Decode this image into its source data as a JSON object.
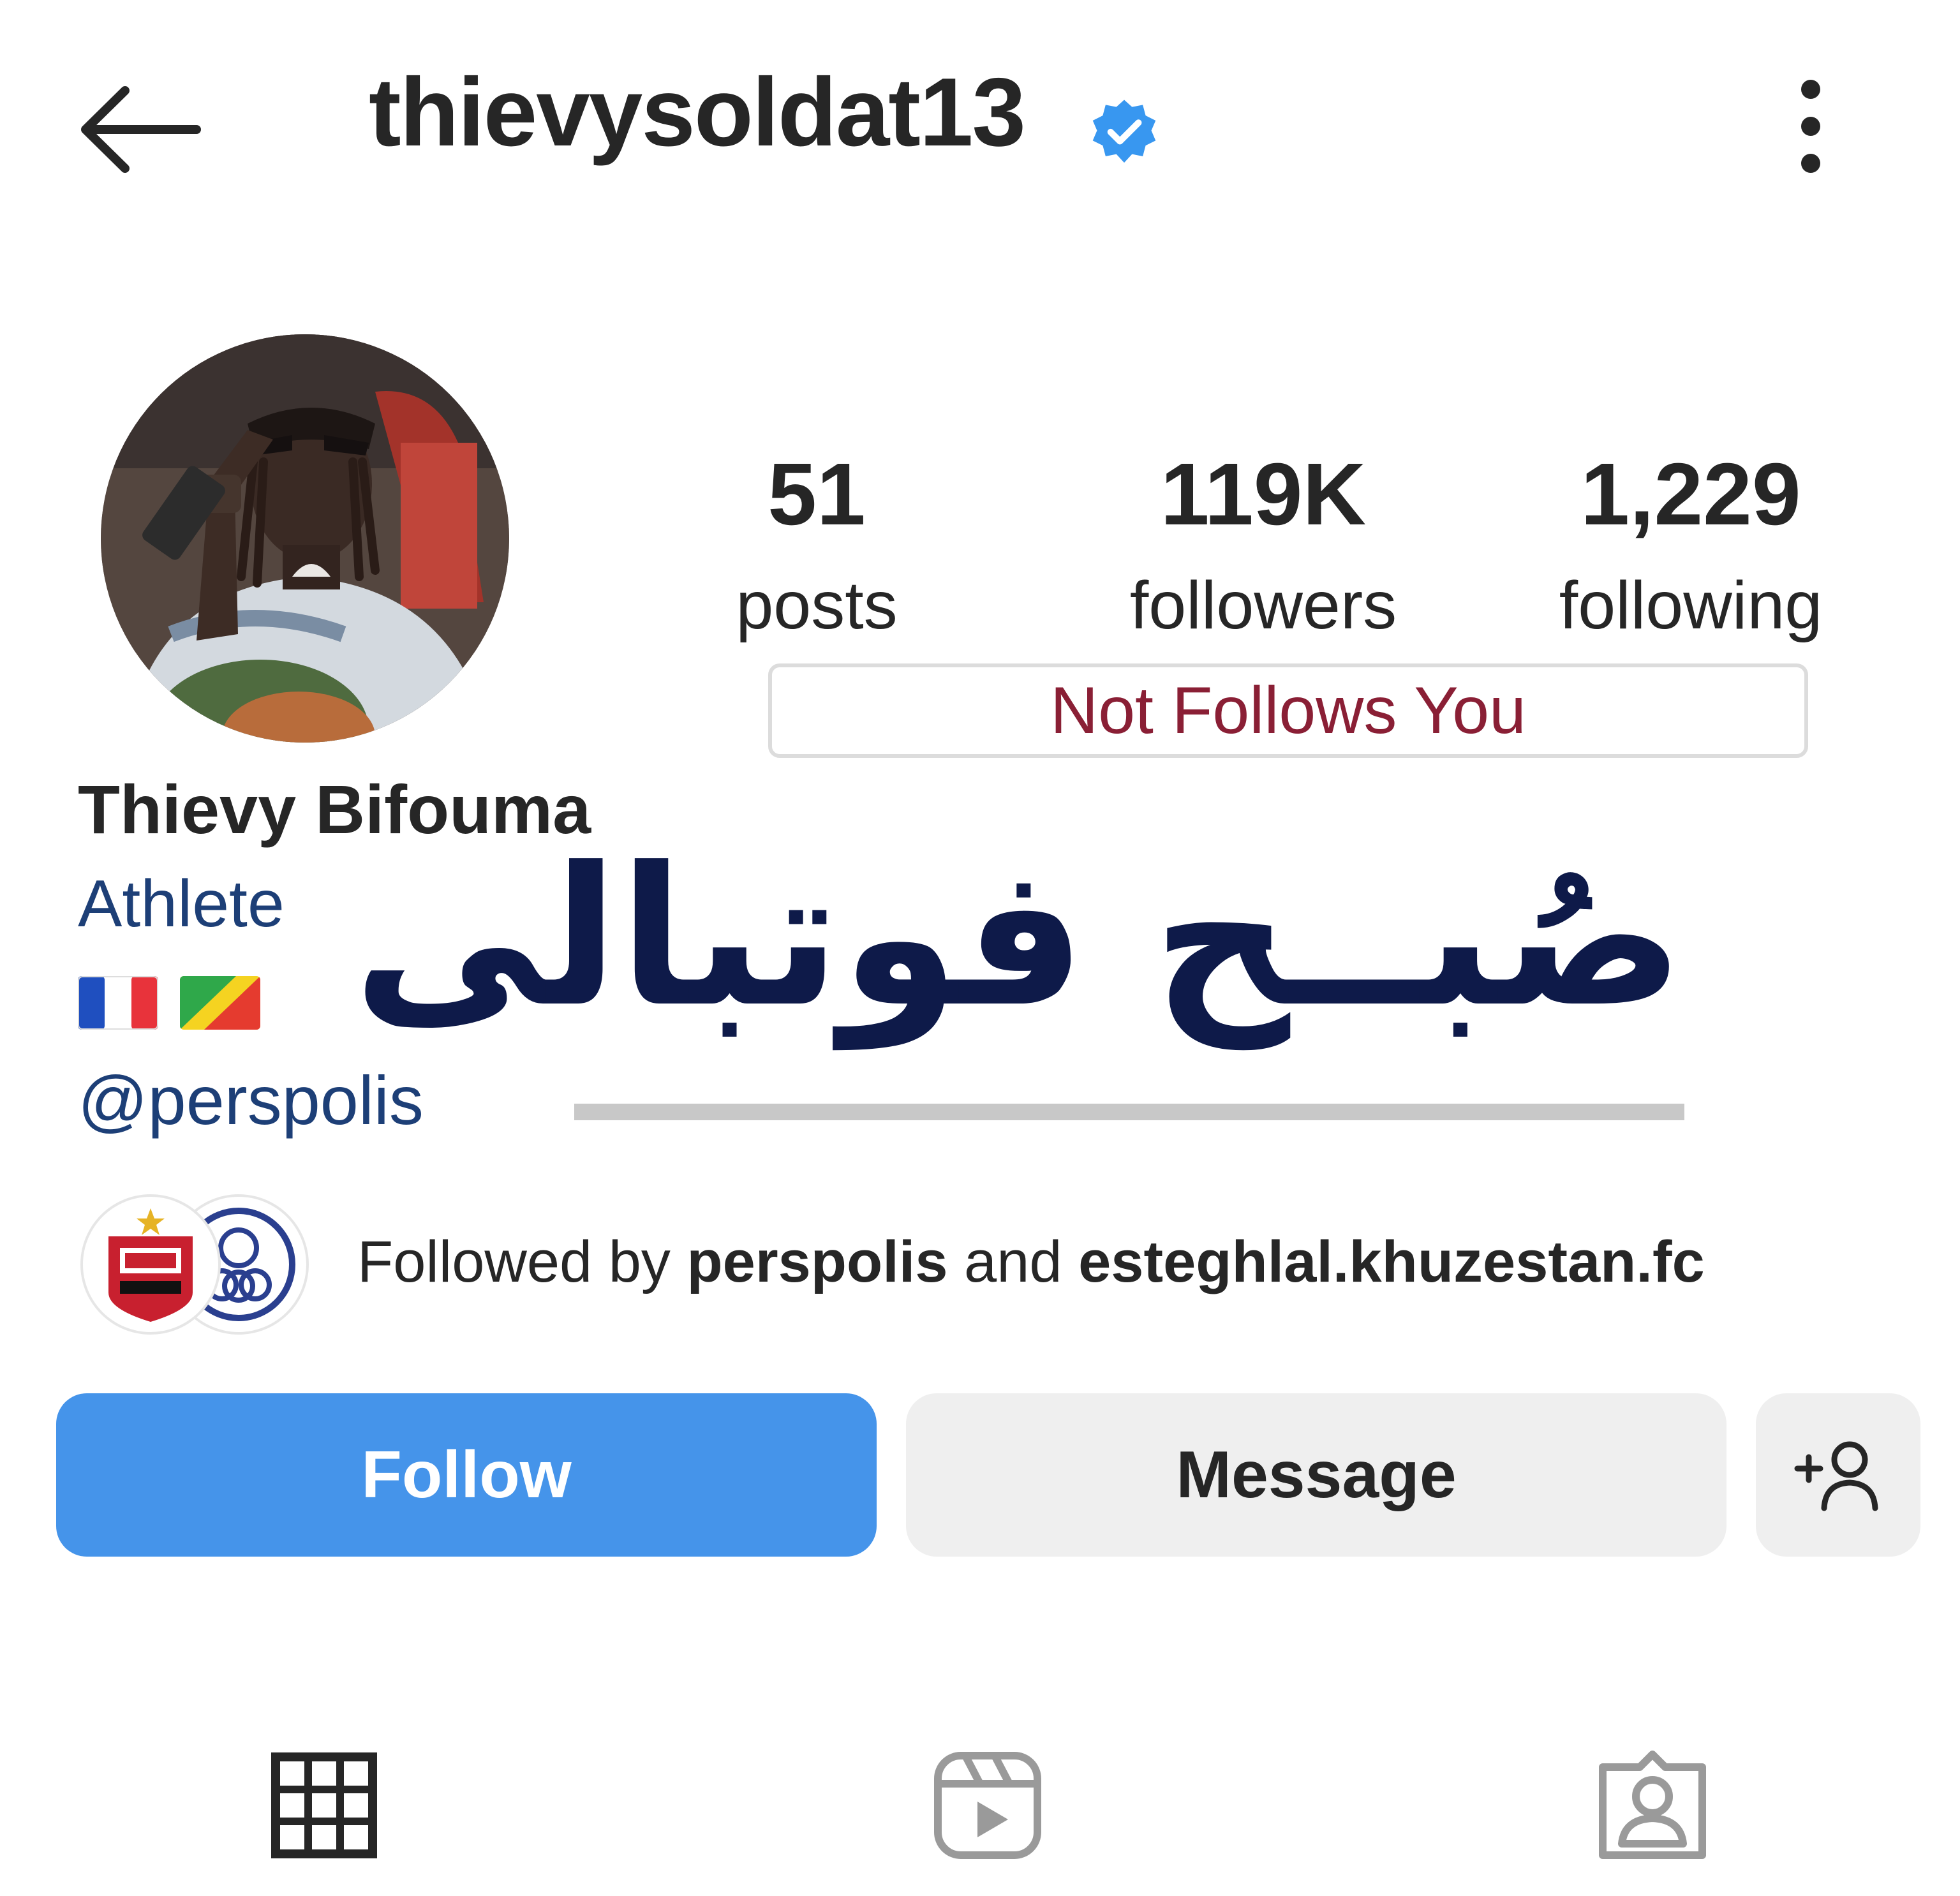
{
  "header": {
    "username": "thievysoldat13",
    "icons": {
      "back": "back-arrow-icon",
      "verified": "verified-badge-icon",
      "more": "more-options-icon"
    }
  },
  "profile": {
    "stats": [
      {
        "value": "51",
        "label": "posts"
      },
      {
        "value": "119K",
        "label": "followers"
      },
      {
        "value": "1,229",
        "label": "following"
      }
    ],
    "relationship_badge": "Not Follows You",
    "full_name": "Thievy Bifouma",
    "category": "Athlete",
    "flags": [
      "🇫🇷",
      "🇨🇬"
    ],
    "mention": "@perspolis"
  },
  "watermark": {
    "text": "صُبــح فوتبالی"
  },
  "followed_by": {
    "prefix": "Followed by",
    "first": "perspolis",
    "conjunction": "and",
    "second": "esteghlal.khuzestan.fc"
  },
  "actions": {
    "follow": "Follow",
    "message": "Message",
    "suggest_icon": "add-person-icon"
  },
  "tabs": [
    {
      "icon": "grid-icon"
    },
    {
      "icon": "reels-icon"
    },
    {
      "icon": "tagged-icon"
    }
  ],
  "colors": {
    "follow_blue": "#4594ea",
    "verified_blue": "#3897f0",
    "link_blue": "#1d3f77",
    "badge_red": "#8a1f35",
    "watermark_navy": "#0e1a49"
  }
}
